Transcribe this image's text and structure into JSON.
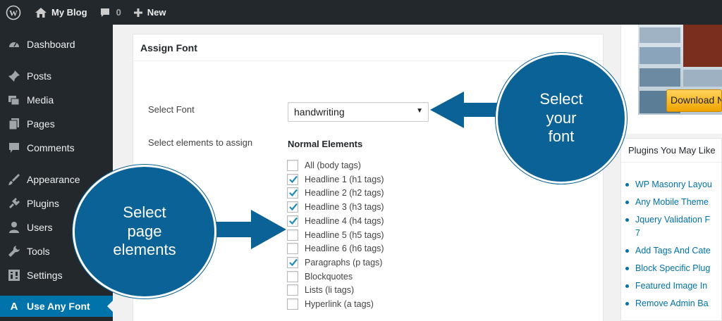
{
  "adminbar": {
    "site_name": "My Blog",
    "comments_count": "0",
    "new_label": "New"
  },
  "sidebar": {
    "items": [
      {
        "label": "Dashboard",
        "icon": "dashboard-icon"
      },
      {
        "label": "Posts",
        "icon": "pin-icon"
      },
      {
        "label": "Media",
        "icon": "media-icon"
      },
      {
        "label": "Pages",
        "icon": "pages-icon"
      },
      {
        "label": "Comments",
        "icon": "comment-icon"
      },
      {
        "label": "Appearance",
        "icon": "brush-icon"
      },
      {
        "label": "Plugins",
        "icon": "plug-icon"
      },
      {
        "label": "Users",
        "icon": "user-icon"
      },
      {
        "label": "Tools",
        "icon": "wrench-icon"
      },
      {
        "label": "Settings",
        "icon": "settings-icon"
      },
      {
        "label": "Use Any Font",
        "icon": "font-a-icon",
        "active": true
      }
    ]
  },
  "panel": {
    "title": "Assign Font",
    "select_font_label": "Select Font",
    "select_font_value": "handwriting",
    "select_elements_label": "Select elements to assign",
    "normal_elements_heading": "Normal Elements",
    "elements": [
      {
        "label": "All (body tags)",
        "checked": false
      },
      {
        "label": "Headline 1 (h1 tags)",
        "checked": true
      },
      {
        "label": "Headline 2 (h2 tags)",
        "checked": true
      },
      {
        "label": "Headline 3 (h3 tags)",
        "checked": true
      },
      {
        "label": "Headline 4 (h4 tags)",
        "checked": true
      },
      {
        "label": "Headline 5 (h5 tags)",
        "checked": false
      },
      {
        "label": "Headline 6 (h6 tags)",
        "checked": false
      },
      {
        "label": "Paragraphs (p tags)",
        "checked": true
      },
      {
        "label": "Blockquotes",
        "checked": false
      },
      {
        "label": "Lists (li tags)",
        "checked": false
      },
      {
        "label": "Hyperlink (a tags)",
        "checked": false
      }
    ]
  },
  "right": {
    "download_label": "Download N",
    "plugins_title": "Plugins You May Like",
    "plugins": [
      "WP Masonry Layou",
      "Any Mobile Theme",
      "Jquery Validation F",
      "7",
      "Add Tags And Cate",
      "Block Specific Plug",
      "Featured Image In",
      "Remove Admin Ba"
    ]
  },
  "callouts": {
    "font": "Select\nyour\nfont",
    "elements": "Select\npage\nelements"
  },
  "colors": {
    "admin_dark": "#23282d",
    "wp_blue": "#0073aa",
    "callout_blue": "#0a6296"
  }
}
